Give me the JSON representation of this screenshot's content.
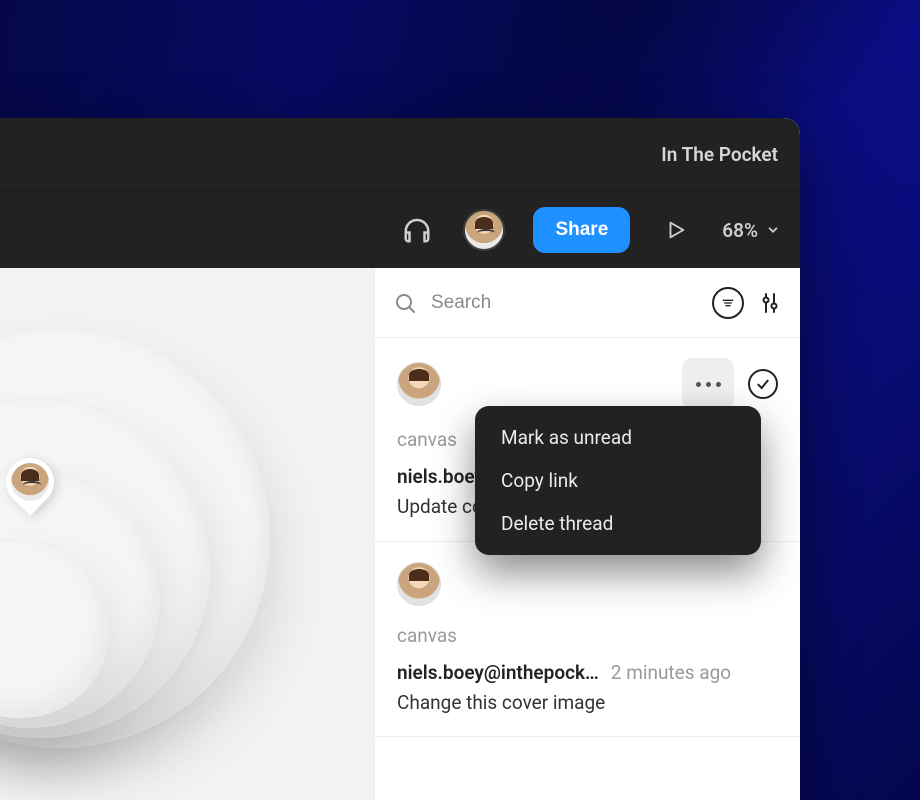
{
  "header": {
    "workspace": "In The Pocket"
  },
  "toolbar": {
    "share_label": "Share",
    "zoom": "68%"
  },
  "search": {
    "placeholder": "Search"
  },
  "comments": [
    {
      "location": "canvas",
      "author": "niels.boey@inthepock…",
      "time": "",
      "body": "Update co"
    },
    {
      "location": "canvas",
      "author": "niels.boey@inthepock…",
      "time": "2 minutes ago",
      "body": "Change this cover image"
    }
  ],
  "context_menu": {
    "items": [
      "Mark as unread",
      "Copy link",
      "Delete thread"
    ]
  }
}
